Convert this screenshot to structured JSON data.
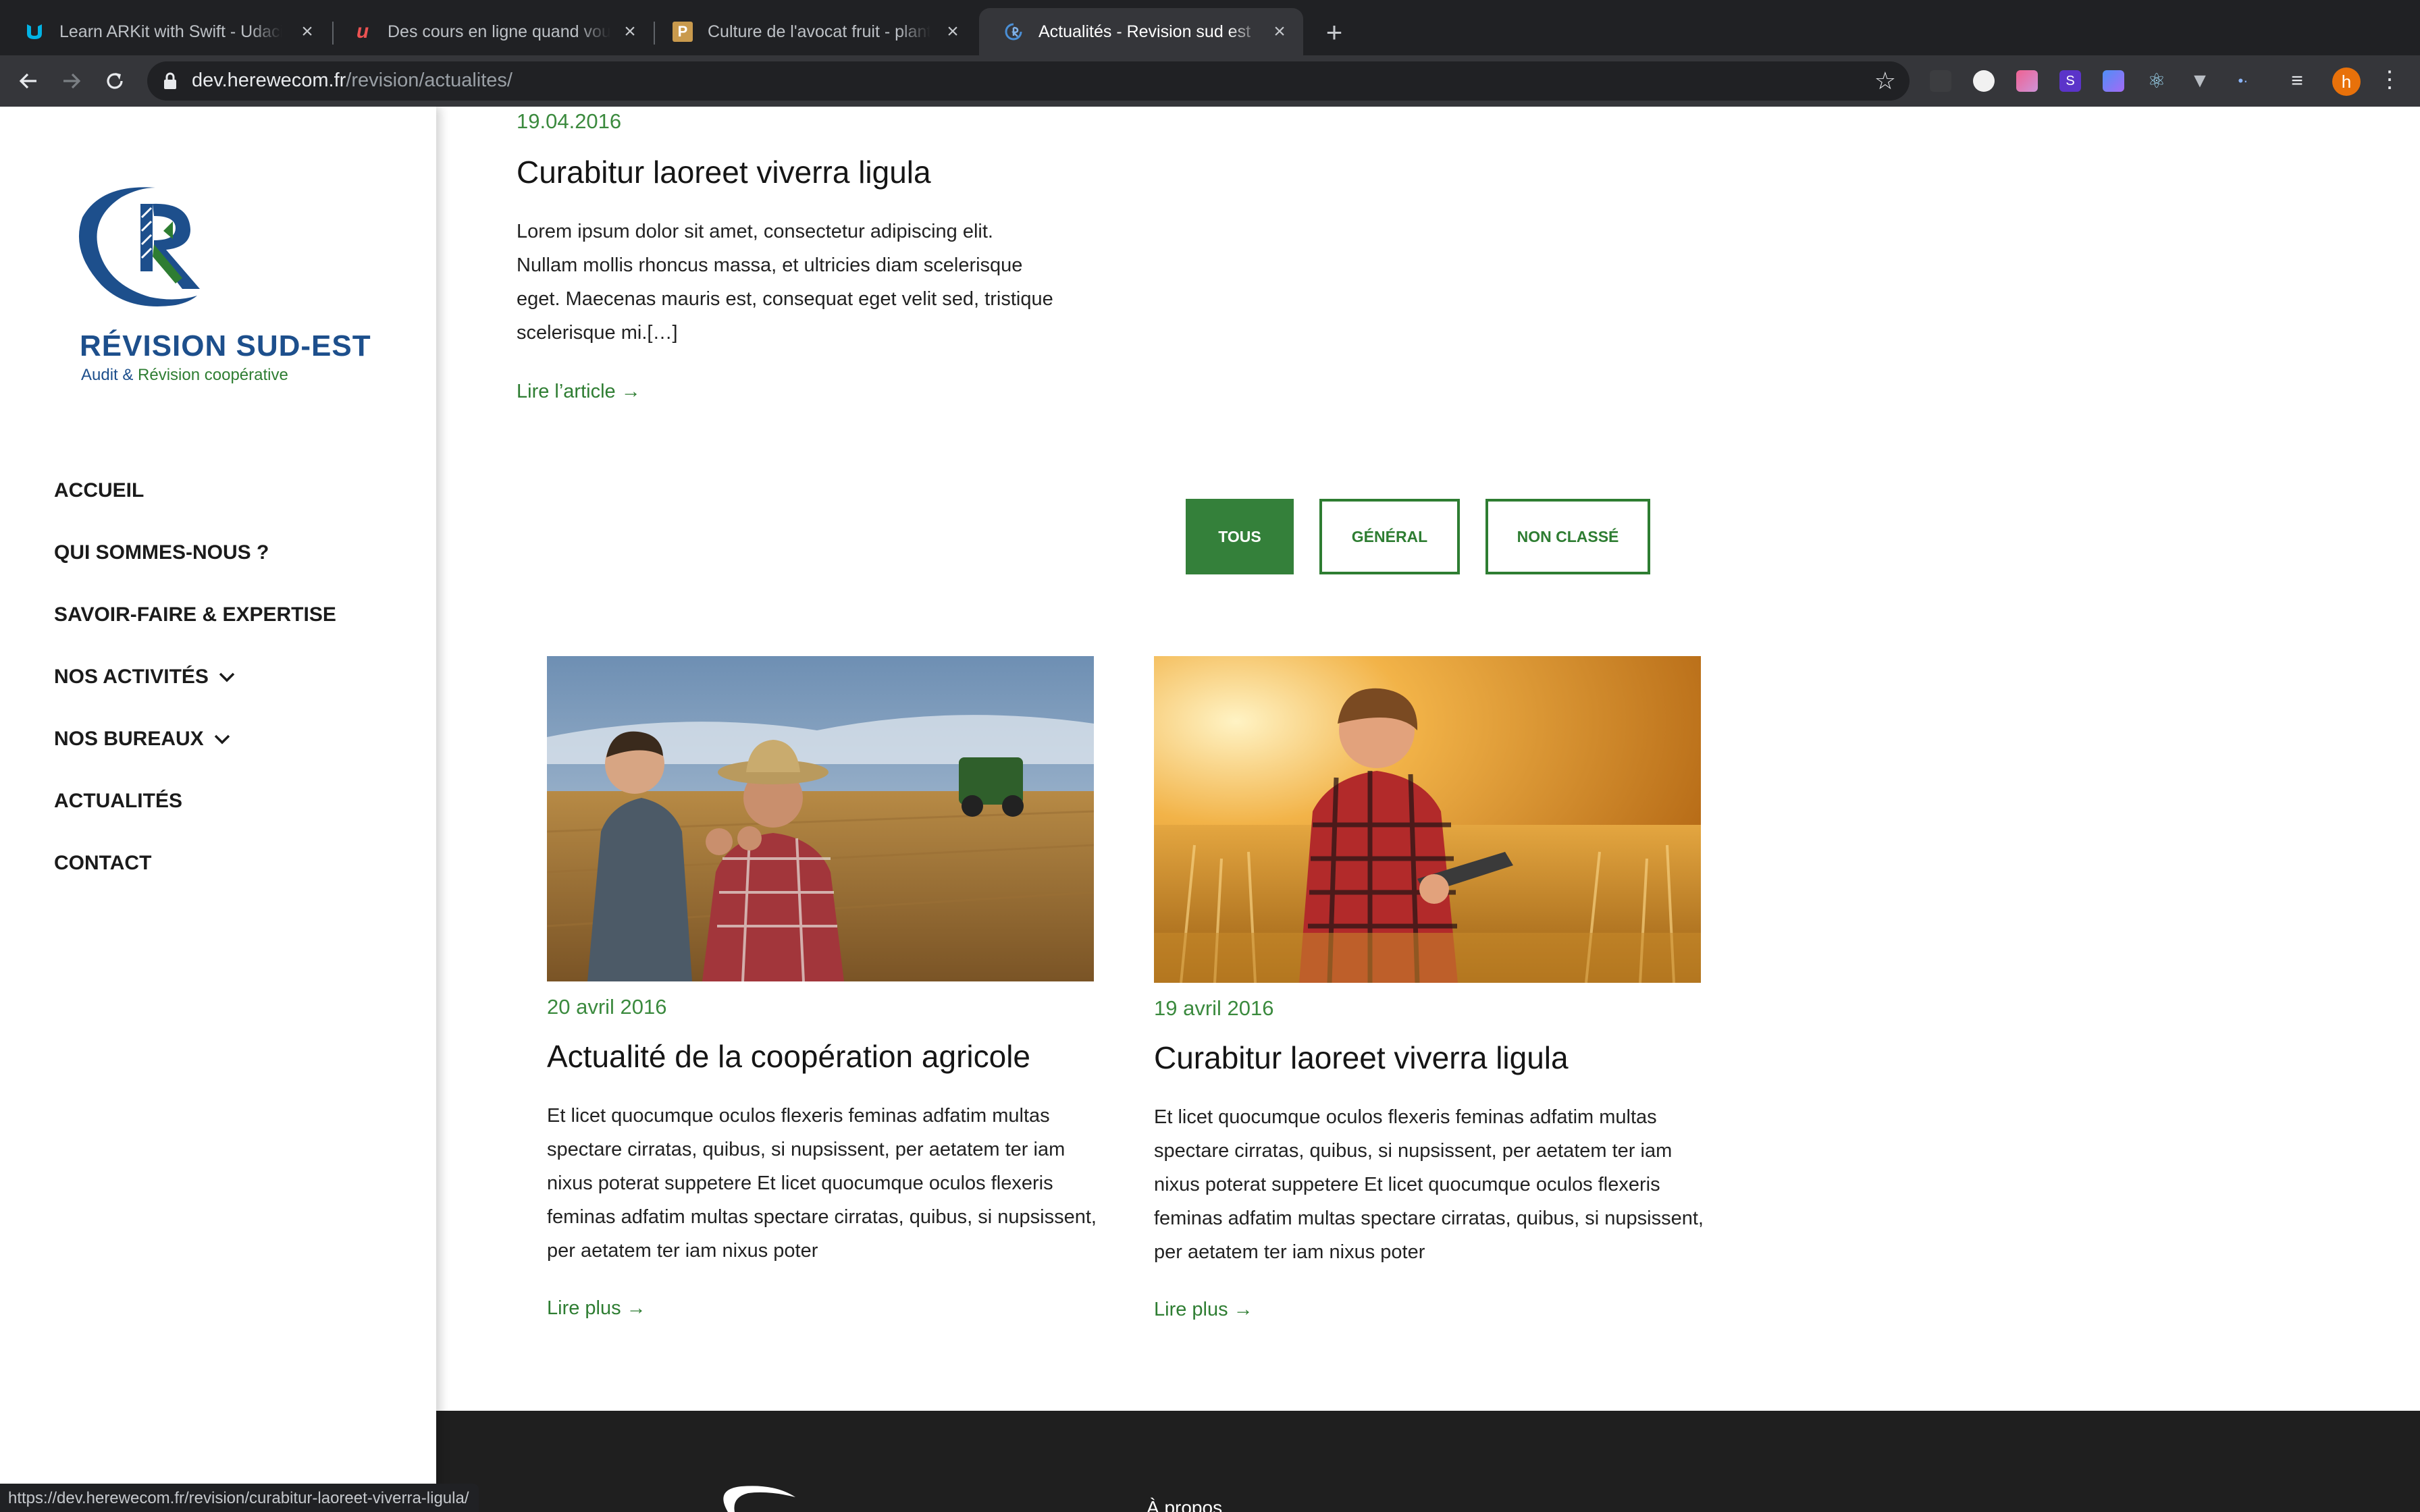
{
  "browser": {
    "tabs": [
      {
        "title": "Learn ARKit with Swift - Udacity",
        "favicon": "udacity-icon"
      },
      {
        "title": "Des cours en ligne quand vous voulez",
        "favicon": "udemy-icon"
      },
      {
        "title": "Culture de l'avocat fruit - plante",
        "favicon": "page-p-icon"
      },
      {
        "title": "Actualités - Revision sud est",
        "favicon": "revision-icon"
      }
    ],
    "url_host": "dev.herewecom.fr",
    "url_path": "/revision/actualites/",
    "profile_initial": "h",
    "status_url": "https://dev.herewecom.fr/revision/curabitur-laoreet-viverra-ligula/"
  },
  "sidebar": {
    "brand_name": "RÉVISION SUD-EST",
    "tagline_part1": "Audit & ",
    "tagline_part2": "Révision coopérative",
    "nav": [
      {
        "label": "ACCUEIL"
      },
      {
        "label": "QUI SOMMES-NOUS ?"
      },
      {
        "label": "SAVOIR-FAIRE & EXPERTISE"
      },
      {
        "label": "NOS ACTIVITÉS",
        "has_dropdown": true
      },
      {
        "label": "NOS BUREAUX",
        "has_dropdown": true
      },
      {
        "label": "ACTUALITÉS"
      },
      {
        "label": "CONTACT"
      }
    ]
  },
  "featured": {
    "date": "19.04.2016",
    "title": "Curabitur laoreet viverra ligula",
    "excerpt": "Lorem ipsum dolor sit amet, consectetur adipiscing elit. Nullam mollis rhoncus massa, et ultricies diam scelerisque eget. Maecenas mauris est, consequat eget velit sed, tristique scelerisque mi.[…]",
    "link": "Lire l’article →"
  },
  "filters": [
    {
      "label": "TOUS",
      "active": true
    },
    {
      "label": "GÉNÉRAL",
      "active": false
    },
    {
      "label": "NON CLASSÉ",
      "active": false
    }
  ],
  "posts": [
    {
      "date": "20 avril 2016",
      "title": "Actualité de la coopération agricole",
      "excerpt": "Et licet quocumque oculos flexeris feminas adfatim multas spectare cirratas, quibus, si nupsissent, per aetatem ter iam nixus poterat suppetere Et licet quocumque oculos flexeris feminas adfatim multas spectare cirratas, quibus, si nupsissent, per aetatem ter iam nixus poter",
      "link": "Lire plus →"
    },
    {
      "date": "19 avril 2016",
      "title": "Curabitur laoreet viverra ligula",
      "excerpt": "Et licet quocumque oculos flexeris feminas adfatim multas spectare cirratas, quibus, si nupsissent, per aetatem ter iam nixus poterat suppetere Et licet quocumque oculos flexeris feminas adfatim multas spectare cirratas, quibus, si nupsissent, per aetatem ter iam nixus poter",
      "link": "Lire plus →"
    }
  ],
  "footer": {
    "heading": "À propos"
  },
  "colors": {
    "accent_green": "#2e7d32",
    "brand_blue": "#1d4f8c",
    "footer_bg": "#1f1f1f"
  }
}
